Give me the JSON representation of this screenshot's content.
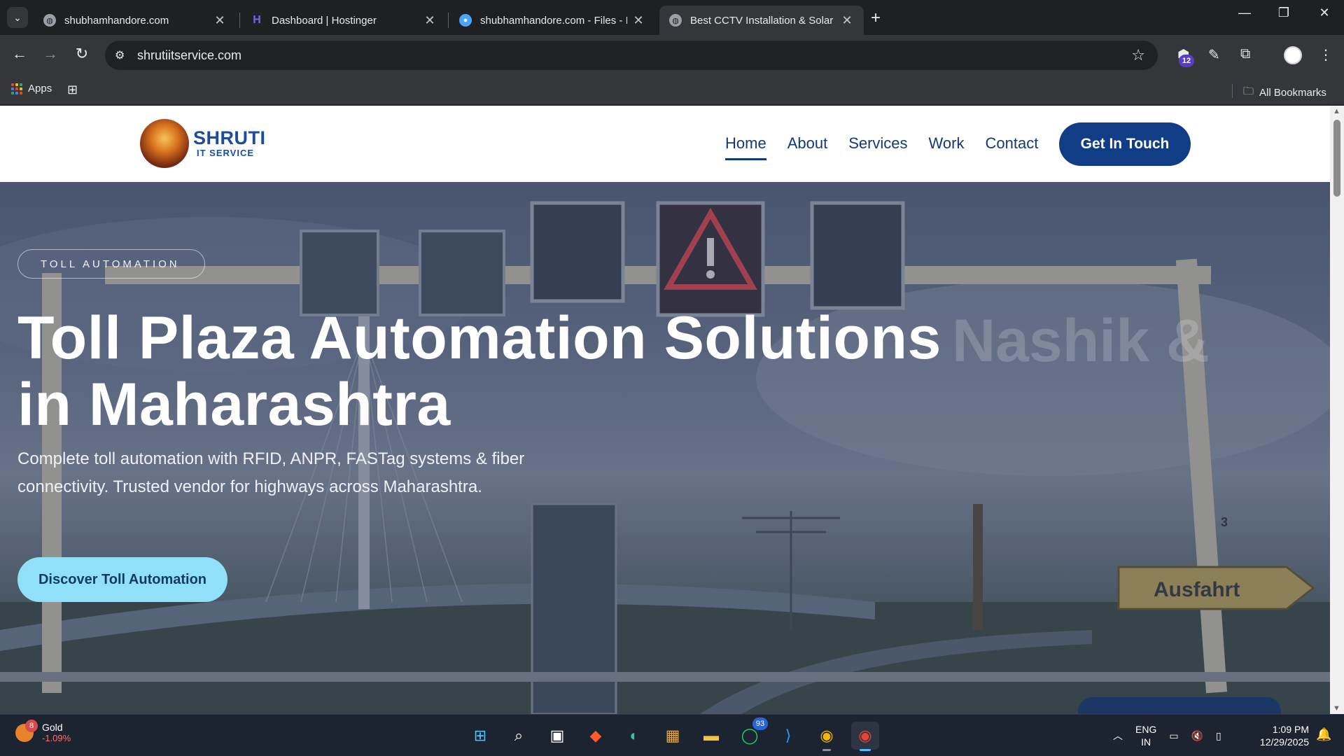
{
  "browser": {
    "tabs": [
      {
        "title": "shubhamhandore.com",
        "active": false
      },
      {
        "title": "Dashboard | Hostinger",
        "active": false
      },
      {
        "title": "shubhamhandore.com - Files - I",
        "active": false
      },
      {
        "title": "Best CCTV Installation & Solar F",
        "active": true
      }
    ],
    "url": "shrutiitservice.com",
    "extension_badge": "12",
    "bookmarks": {
      "apps_label": "Apps",
      "all_bookmarks_label": "All Bookmarks"
    }
  },
  "site": {
    "logo": {
      "name": "SHRUTI",
      "subtitle": "IT SERVICE"
    },
    "nav": [
      {
        "label": "Home",
        "active": true
      },
      {
        "label": "About",
        "active": false
      },
      {
        "label": "Services",
        "active": false
      },
      {
        "label": "Work",
        "active": false
      },
      {
        "label": "Contact",
        "active": false
      }
    ],
    "cta_label": "Get In Touch",
    "hero": {
      "tag": "TOLL AUTOMATION",
      "heading": "Toll Plaza Automation Solutions in Maharashtra",
      "ghost_text": "Nashik &",
      "lead": "Complete toll automation with RFID, ANPR, FASTag systems & fiber connectivity. Trusted vendor for highways across Maharashtra.",
      "button_label": "Discover Toll Automation",
      "sign_text": "Ausfahrt",
      "sign_number": "3"
    }
  },
  "taskbar": {
    "widget": {
      "title": "Gold",
      "change": "-1.09%",
      "badge": "8"
    },
    "whatsapp_badge": "93",
    "language": {
      "line1": "ENG",
      "line2": "IN"
    },
    "time": "1:09 PM",
    "date": "12/29/2025"
  },
  "colors": {
    "brand_blue": "#113d86",
    "hero_button": "#8fe0f8",
    "browser_dark": "#35363a"
  }
}
